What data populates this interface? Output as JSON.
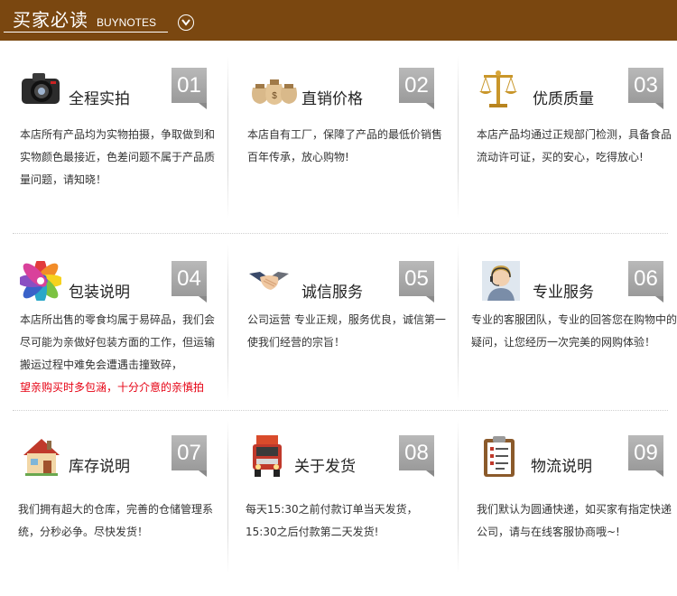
{
  "header": {
    "title": "买家必读",
    "subtitle": "BUYNOTES"
  },
  "colors": {
    "header_bg": "#7a4710",
    "badge_bg": "#a8a8a8",
    "warning_text": "#e60012"
  },
  "cards": [
    {
      "icon": "camera-icon",
      "title": "全程实拍",
      "num": "01",
      "desc": "本店所有产品均为实物拍摄，争取做到和实物颜色最接近，色差问题不属于产品质量问题，请知晓！"
    },
    {
      "icon": "money-bags-icon",
      "title": "直销价格",
      "num": "02",
      "desc": "本店自有工厂，保障了产品的最低价销售百年传承，放心购物!"
    },
    {
      "icon": "scales-icon",
      "title": "优质质量",
      "num": "03",
      "desc": "本店产品均通过正规部门检测，具备食品流动许可证，买的安心，吃得放心!"
    },
    {
      "icon": "color-wheel-icon",
      "title": "包装说明",
      "num": "04",
      "desc": "本店所出售的零食均属于易碎品，我们会尽可能为亲做好包装方面的工作，但运输搬运过程中难免会遭遇击撞致碎，",
      "warning": "望亲购买时多包涵，十分介意的亲慎拍"
    },
    {
      "icon": "handshake-icon",
      "title": "诚信服务",
      "num": "05",
      "desc": "公司运营 专业正规，服务优良，诚信第一使我们经营的宗旨！"
    },
    {
      "icon": "customer-service-icon",
      "title": "专业服务",
      "num": "06",
      "desc": "专业的客服团队，专业的回答您在购物中的疑问，让您经历一次完美的网购体验！"
    },
    {
      "icon": "house-icon",
      "title": "库存说明",
      "num": "07",
      "desc": "我们拥有超大的仓库，完善的仓储管理系统，分秒必争。尽快发货！"
    },
    {
      "icon": "truck-icon",
      "title": "关于发货",
      "num": "08",
      "desc": "每天15:30之前付款订单当天发货，15:30之后付款第二天发货!"
    },
    {
      "icon": "clipboard-icon",
      "title": "物流说明",
      "num": "09",
      "desc": "我们默认为圆通快递，如买家有指定快递公司，请与在线客服协商哦~!"
    }
  ]
}
